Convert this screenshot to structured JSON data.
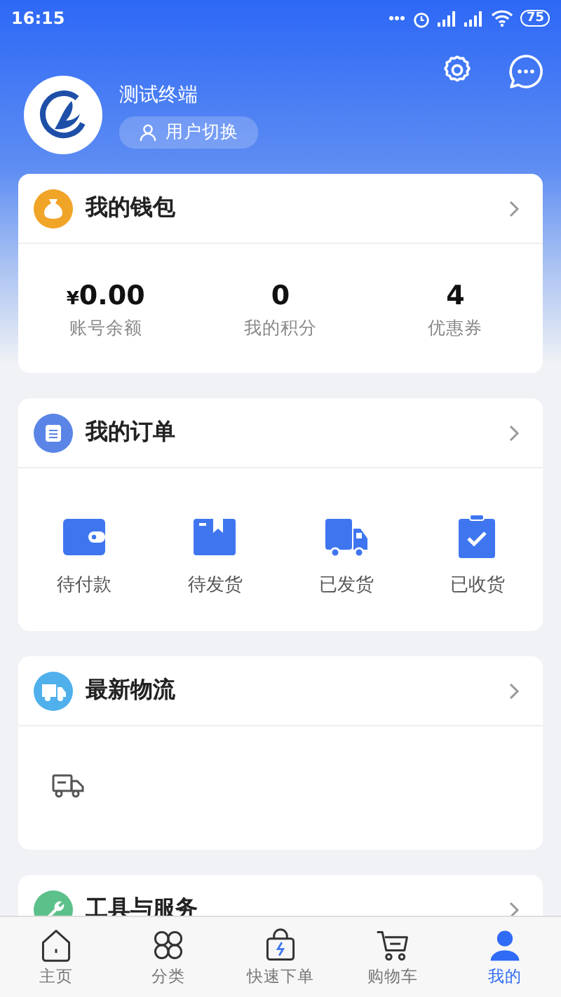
{
  "status_bar": {
    "time": "16:15",
    "battery": "75"
  },
  "profile": {
    "name": "测试终端",
    "switch_button": "用户切换"
  },
  "wallet": {
    "title": "我的钱包",
    "stats": [
      {
        "currency": "¥",
        "value": "0.00",
        "label": "账号余额"
      },
      {
        "value": "0",
        "label": "我的积分"
      },
      {
        "value": "4",
        "label": "优惠券"
      }
    ]
  },
  "orders": {
    "title": "我的订单",
    "items": [
      {
        "kind": "wallet",
        "label": "待付款"
      },
      {
        "kind": "box",
        "label": "待发货"
      },
      {
        "kind": "truck",
        "label": "已发货"
      },
      {
        "kind": "clipboard",
        "label": "已收货"
      }
    ]
  },
  "logistics": {
    "title": "最新物流"
  },
  "tools": {
    "title": "工具与服务"
  },
  "tabs": [
    {
      "kind": "home",
      "label": "主页",
      "selected": false
    },
    {
      "kind": "category",
      "label": "分类",
      "selected": false
    },
    {
      "kind": "bag",
      "label": "快速下单",
      "selected": false
    },
    {
      "kind": "cart",
      "label": "购物车",
      "selected": false
    },
    {
      "kind": "user",
      "label": "我的",
      "selected": true
    }
  ]
}
